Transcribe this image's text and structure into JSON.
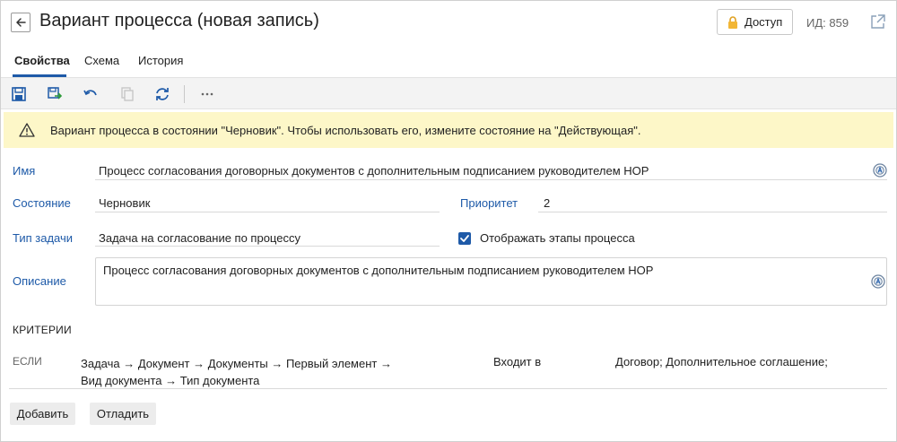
{
  "header": {
    "title": "Вариант процесса (новая запись)",
    "access_label": "Доступ",
    "id_label": "ИД: 859"
  },
  "tabs": [
    {
      "label": "Свойства",
      "active": true
    },
    {
      "label": "Схема",
      "active": false
    },
    {
      "label": "История",
      "active": false
    }
  ],
  "toolbar": {
    "icons": [
      "save-icon",
      "save-as-icon",
      "undo-icon",
      "copy-icon",
      "refresh-icon",
      "more-icon"
    ]
  },
  "warning": {
    "text": "Вариант процесса в состоянии \"Черновик\". Чтобы использовать его, измените состояние на \"Действующая\"."
  },
  "form": {
    "name_label": "Имя",
    "name_value": "Процесс согласования договорных документов с дополнительным подписанием руководителем НОР",
    "state_label": "Состояние",
    "state_value": "Черновик",
    "priority_label": "Приоритет",
    "priority_value": "2",
    "task_type_label": "Тип задачи",
    "task_type_value": "Задача на согласование по процессу",
    "show_stages_label": "Отображать этапы процесса",
    "show_stages_checked": true,
    "description_label": "Описание",
    "description_value": "Процесс согласования договорных документов с дополнительным подписанием руководителем НОР"
  },
  "criteria": {
    "title": "КРИТЕРИИ",
    "if_label": "ЕСЛИ",
    "path_line1": "Задача → Документ → Документы → Первый элемент →",
    "path_line2": "Вид документа → Тип документа",
    "operator": "Входит в",
    "value": "Договор; Дополнительное соглашение;"
  },
  "buttons": {
    "add": "Добавить",
    "debug": "Отладить"
  },
  "colors": {
    "accent": "#1e5aa8",
    "warning_bg": "#fdf7c8",
    "toolbar_bg": "#f3f3f3"
  }
}
